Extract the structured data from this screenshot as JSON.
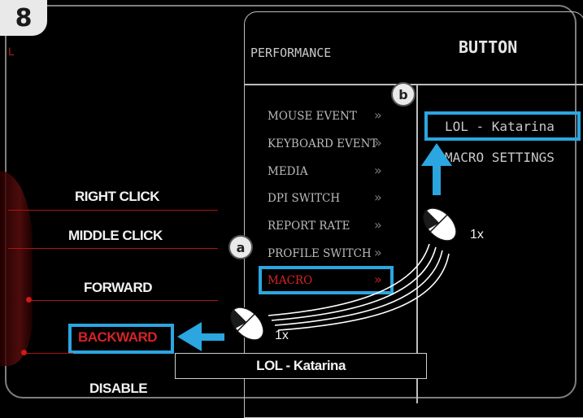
{
  "step_badge": "8",
  "mouse_side_labels": [
    {
      "label": "RIGHT CLICK"
    },
    {
      "label": "MIDDLE CLICK"
    },
    {
      "label": "FORWARD"
    },
    {
      "label": "BACKWARD"
    },
    {
      "label": "DISABLE"
    }
  ],
  "panel": {
    "tabs": [
      "PERFORMANCE",
      "BUTTON"
    ],
    "menu": [
      {
        "label": "MOUSE EVENT"
      },
      {
        "label": "KEYBOARD EVENT"
      },
      {
        "label": "MEDIA"
      },
      {
        "label": "DPI SWITCH"
      },
      {
        "label": "REPORT RATE"
      },
      {
        "label": "PROFILE SWITCH"
      },
      {
        "label": "MACRO"
      }
    ],
    "submenu": [
      {
        "label": "LOL - Katarina"
      },
      {
        "label": "MACRO SETTINGS"
      }
    ]
  },
  "tags": {
    "a": "a",
    "b": "b"
  },
  "click_count_macro": "1x",
  "click_count_submenu": "1x",
  "assigned_result": "LOL - Katarina",
  "colors": {
    "accent": "#2ba6e0",
    "selected": "#d42424",
    "line": "#b01212"
  }
}
